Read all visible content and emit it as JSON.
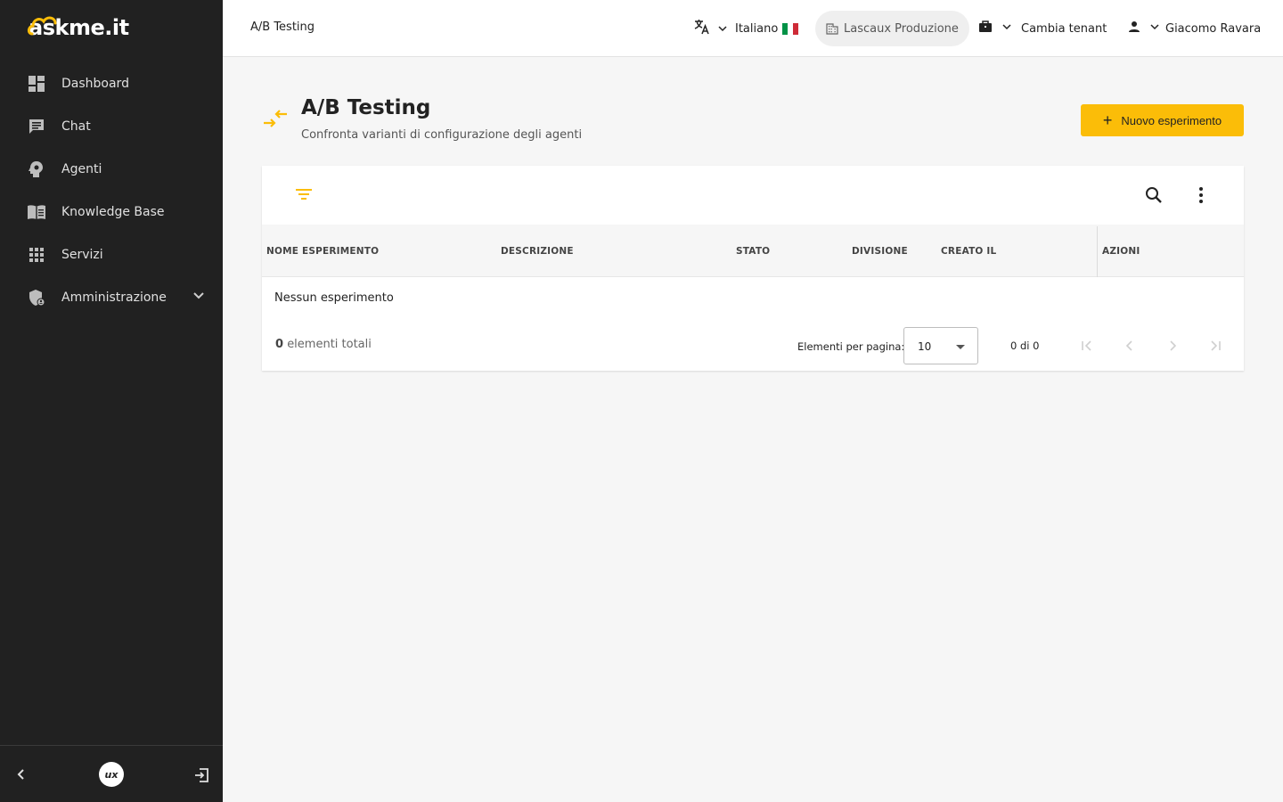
{
  "app": {
    "logo_text": "askme.it"
  },
  "sidebar": {
    "items": [
      {
        "label": "Dashboard",
        "icon": "dashboard-icon"
      },
      {
        "label": "Chat",
        "icon": "chat-icon"
      },
      {
        "label": "Agenti",
        "icon": "agent-head-icon"
      },
      {
        "label": "Knowledge Base",
        "icon": "book-icon"
      },
      {
        "label": "Servizi",
        "icon": "grid-icon"
      },
      {
        "label": "Amministrazione",
        "icon": "admin-shield-icon"
      }
    ],
    "footer_badge": "ux"
  },
  "topbar": {
    "breadcrumb": "A/B Testing",
    "language": "Italiano",
    "tenant": "Lascaux Produzione",
    "switch_tenant": "Cambia tenant",
    "user": "Giacomo Ravara"
  },
  "page": {
    "title": "A/B Testing",
    "subtitle": "Confronta varianti di configurazione degli agenti",
    "new_button": "Nuovo esperimento"
  },
  "table": {
    "columns": [
      "NOME ESPERIMENTO",
      "DESCRIZIONE",
      "STATO",
      "DIVISIONE",
      "CREATO IL",
      "AZIONI"
    ],
    "empty_message": "Nessun esperimento",
    "total_count": "0",
    "total_label": "elementi totali",
    "page_size_label": "Elementi per pagina:",
    "page_size": "10",
    "range": "0 di 0"
  },
  "colors": {
    "accent": "#fbbd08",
    "sidebar_bg": "#212121"
  }
}
